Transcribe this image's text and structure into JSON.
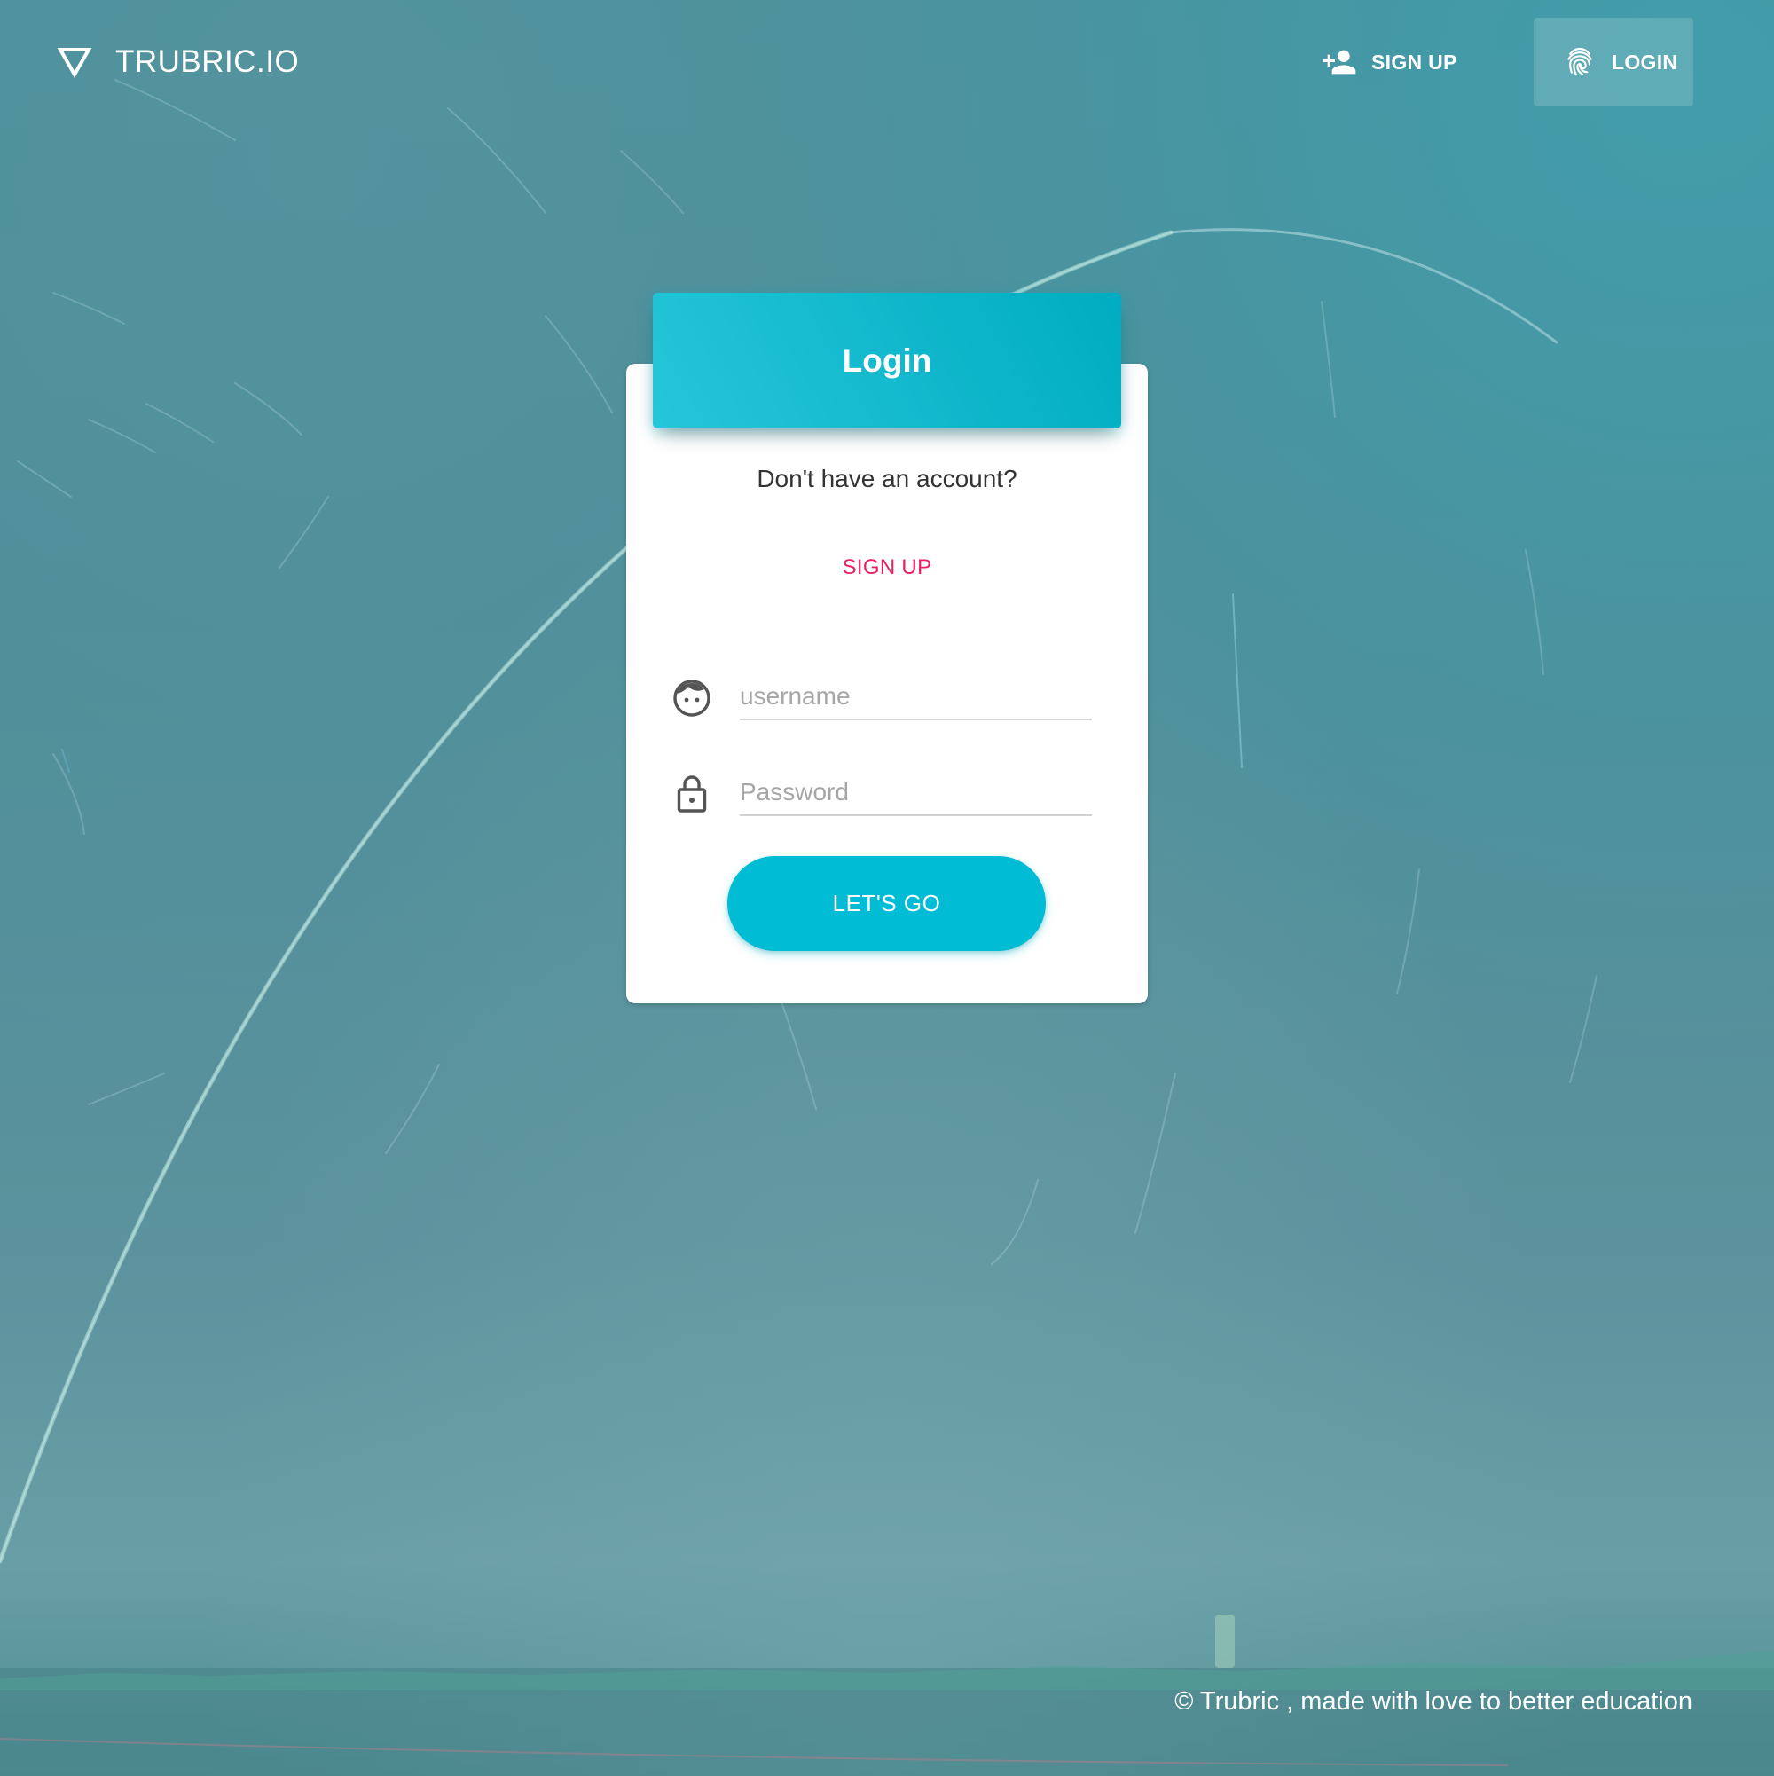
{
  "navbar": {
    "brand_icon": "triangle-down-icon",
    "brand_name": "TRUBRIC.IO",
    "signup_label": "SIGN UP",
    "signup_icon": "person-add-icon",
    "login_label": "LOGIN",
    "login_icon": "fingerprint-icon"
  },
  "card": {
    "title": "Login",
    "prompt": "Don't have an account?",
    "signup_link": "SIGN UP",
    "username": {
      "icon": "face-icon",
      "placeholder": "username",
      "value": ""
    },
    "password": {
      "icon": "lock-icon",
      "placeholder": "Password",
      "value": ""
    },
    "submit_label": "LET'S GO"
  },
  "footer": {
    "text": "© Trubric , made with love to better education"
  },
  "colors": {
    "accent": "#00bcd4",
    "header_gradient_start": "#26c6da",
    "header_gradient_end": "#00acc1",
    "link": "#e91e63",
    "background": "#4f8e99"
  }
}
